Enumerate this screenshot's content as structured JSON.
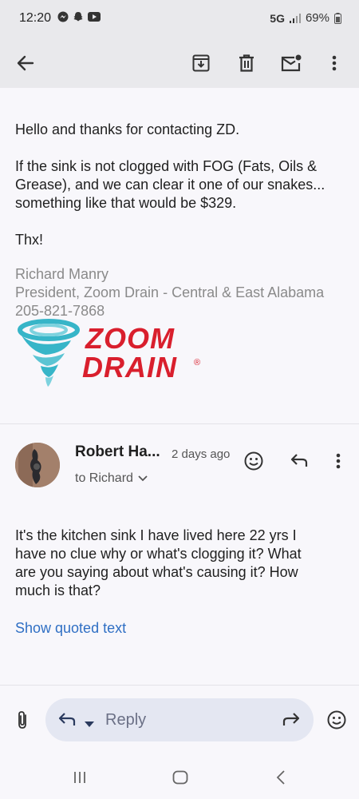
{
  "status": {
    "time": "12:20",
    "network": "5G",
    "battery": "69%"
  },
  "message_top": {
    "greeting": "Hello and thanks for contacting ZD.",
    "body_line1": "If the sink is not clogged with FOG (Fats, Oils &",
    "body_line2": "Grease), and we can clear it one of our snakes...",
    "body_line3": "something like that would be $329.",
    "thanks": "Thx!",
    "sig_name": "Richard Manry",
    "sig_title": "President, Zoom Drain - Central & East Alabama",
    "sig_phone": "205-821-7868",
    "logo_word1": "ZOOM",
    "logo_word2": "DRAIN",
    "logo_reg": "®",
    "brand_color": "#d91f2d"
  },
  "message2": {
    "sender": "Robert Ha...",
    "date": "2 days ago",
    "to": "to Richard",
    "body_line1": "It's the kitchen sink I have lived here 22 yrs I",
    "body_line2": "have no clue why or what's clogging it? What",
    "body_line3": "are you saying about what's causing it? How",
    "body_line4": "much is that?",
    "show_quoted": "Show quoted text"
  },
  "compose": {
    "reply_placeholder": "Reply"
  },
  "icons": {
    "back": "back-arrow-icon",
    "archive": "archive-icon",
    "delete": "trash-icon",
    "unread": "mark-unread-icon",
    "more": "more-vert-icon",
    "emoji": "emoji-icon",
    "reply": "reply-icon",
    "attach": "attach-icon",
    "forward": "forward-icon"
  }
}
